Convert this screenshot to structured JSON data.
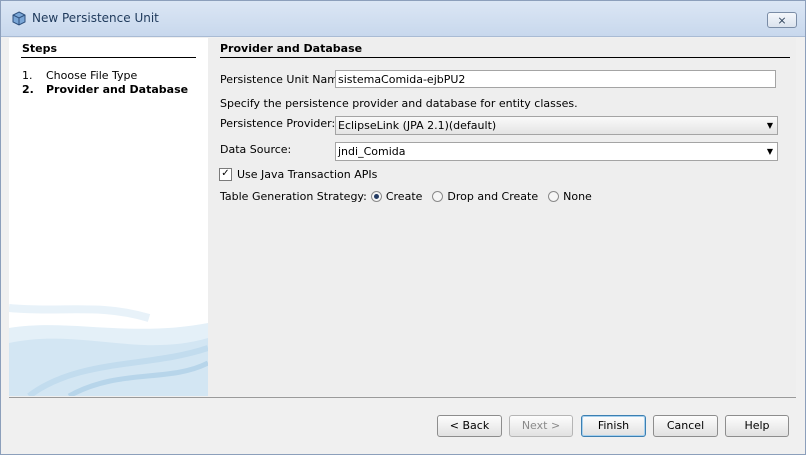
{
  "window": {
    "title": "New Persistence Unit",
    "close_label": "⨯"
  },
  "steps": {
    "heading": "Steps",
    "items": [
      {
        "num": "1.",
        "label": "Choose File Type"
      },
      {
        "num": "2.",
        "label": "Provider and Database"
      }
    ]
  },
  "main": {
    "heading": "Provider and Database",
    "unit_name_label": "Persistence Unit Name:",
    "unit_name_value": "sistemaComida-ejbPU2",
    "description": "Specify the persistence provider and database for entity classes.",
    "provider_label": "Persistence Provider:",
    "provider_value": "EclipseLink (JPA 2.1)(default)",
    "datasource_label": "Data Source:",
    "datasource_value": "jndi_Comida",
    "jta_label": "Use Java Transaction APIs",
    "jta_checked": true,
    "strategy_label": "Table Generation Strategy:",
    "strategy_options": [
      "Create",
      "Drop and Create",
      "None"
    ],
    "strategy_selected": "Create"
  },
  "buttons": {
    "back": "< Back",
    "next": "Next >",
    "finish": "Finish",
    "cancel": "Cancel",
    "help": "Help"
  },
  "colors": {
    "titlebar": "#c8d8ed",
    "steps_graphic": "#cfe3f1"
  }
}
